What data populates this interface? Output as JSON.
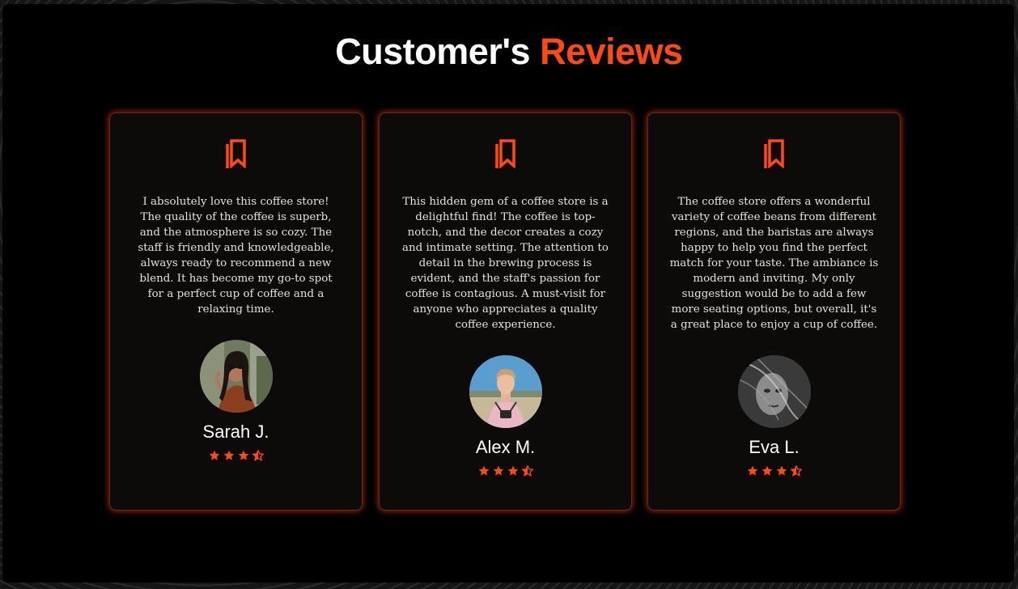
{
  "page": {
    "heading_part1": "Customer's",
    "heading_part2": "Reviews"
  },
  "colors": {
    "accent": "#ff4a12",
    "background": "#000000",
    "card": "#0d0b0a"
  },
  "reviews": [
    {
      "text": "I absolutely love this coffee store! The quality of the coffee is superb, and the atmosphere is so cozy. The staff is friendly and knowledgeable, always ready to recommend a new blend. It has become my go-to spot for a perfect cup of coffee and a relaxing time.",
      "name": "Sarah J.",
      "rating": 3.5,
      "icon": "bookmark-icon"
    },
    {
      "text": "This hidden gem of a coffee store is a delightful find! The coffee is top-notch, and the decor creates a cozy and intimate setting. The attention to detail in the brewing process is evident, and the staff's passion for coffee is contagious. A must-visit for anyone who appreciates a quality coffee experience.",
      "name": "Alex M.",
      "rating": 3.5,
      "icon": "bookmark-icon"
    },
    {
      "text": "The coffee store offers a wonderful variety of coffee beans from different regions, and the baristas are always happy to help you find the perfect match for your taste. The ambiance is modern and inviting. My only suggestion would be to add a few more seating options, but overall, it's a great place to enjoy a cup of coffee.",
      "name": "Eva L.",
      "rating": 3.5,
      "icon": "bookmark-icon"
    }
  ]
}
